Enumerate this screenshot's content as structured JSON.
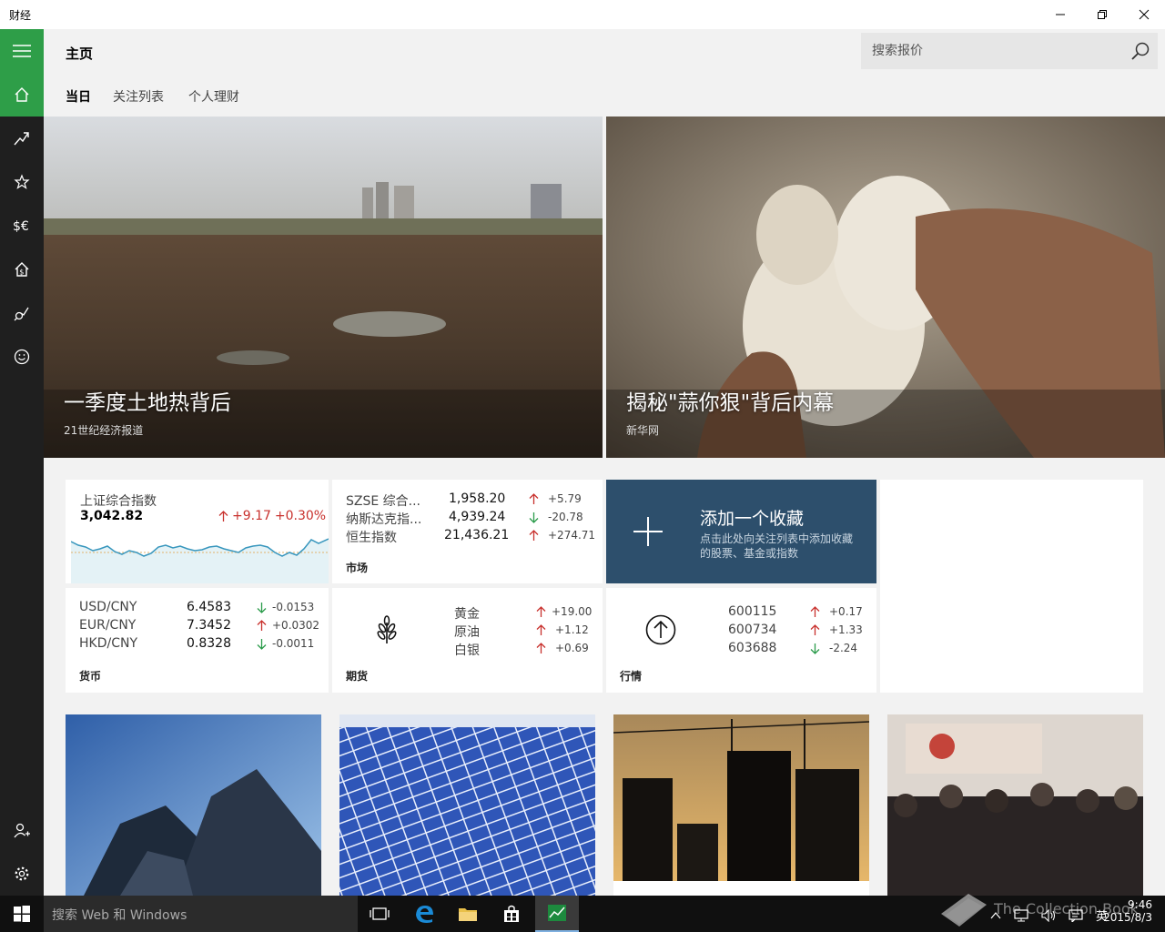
{
  "app": {
    "title": "财经"
  },
  "header": {
    "page_title": "主页",
    "search_placeholder": "搜索报价"
  },
  "tabs": [
    {
      "label": "当日"
    },
    {
      "label": "关注列表"
    },
    {
      "label": "个人理财"
    }
  ],
  "heroes": [
    {
      "caption": "一季度土地热背后",
      "source": "21世纪经济报道"
    },
    {
      "caption": "揭秘\"蒜你狠\"背后内幕",
      "source": "新华网"
    }
  ],
  "index_tile": {
    "name": "上证综合指数",
    "value": "3,042.82",
    "change": "+9.17",
    "percent": "+0.30%"
  },
  "market_tile": {
    "label": "市场",
    "rows": [
      {
        "name": "SZSE 综合...",
        "value": "1,958.20",
        "change": "+5.79",
        "dir": "up"
      },
      {
        "name": "纳斯达克指...",
        "value": "4,939.24",
        "change": "-20.78",
        "dir": "down"
      },
      {
        "name": "恒生指数",
        "value": "21,436.21",
        "change": "+274.71",
        "dir": "up"
      }
    ]
  },
  "add_tile": {
    "title": "添加一个收藏",
    "desc_line1": "点击此处向关注列表中添加收藏",
    "desc_line2": "的股票、基金或指数"
  },
  "currency_tile": {
    "label": "货币",
    "rows": [
      {
        "name": "USD/CNY",
        "value": "6.4583",
        "change": "-0.0153",
        "dir": "down"
      },
      {
        "name": "EUR/CNY",
        "value": "7.3452",
        "change": "+0.0302",
        "dir": "up"
      },
      {
        "name": "HKD/CNY",
        "value": "0.8328",
        "change": "-0.0011",
        "dir": "down"
      }
    ]
  },
  "futures_tile": {
    "label": "期货",
    "rows": [
      {
        "name": "黄金",
        "change": "+19.00",
        "dir": "up"
      },
      {
        "name": "原油",
        "change": "+1.12",
        "dir": "up"
      },
      {
        "name": "白银",
        "change": "+0.69",
        "dir": "up"
      }
    ]
  },
  "quotes_tile": {
    "label": "行情",
    "rows": [
      {
        "name": "600115",
        "change": "+0.17",
        "dir": "up"
      },
      {
        "name": "600734",
        "change": "+1.33",
        "dir": "up"
      },
      {
        "name": "603688",
        "change": "-2.24",
        "dir": "down"
      }
    ]
  },
  "taskbar": {
    "search_placeholder": "搜索 Web 和 Windows",
    "ime": "英",
    "time": "9:46",
    "date": "2015/8/3"
  },
  "watermark": "The Collection Book",
  "colors": {
    "accent": "#2e9e48",
    "add_tile": "#2d4f6c",
    "up": "#c8302c",
    "down": "#2a9b4a"
  }
}
